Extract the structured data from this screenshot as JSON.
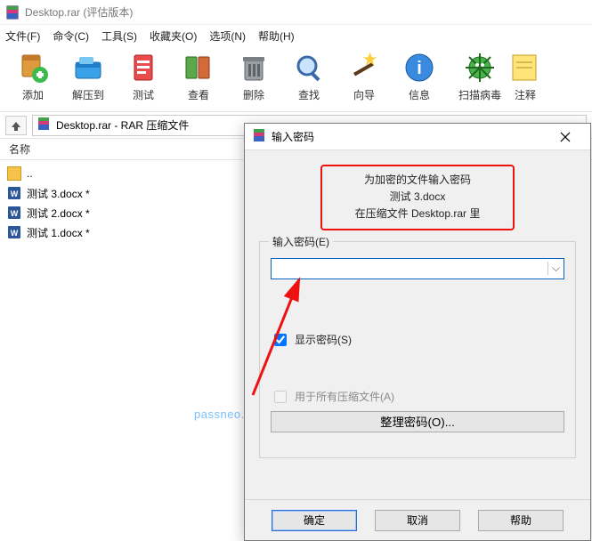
{
  "title": "Desktop.rar (评估版本)",
  "menus": [
    "文件(F)",
    "命令(C)",
    "工具(S)",
    "收藏夹(O)",
    "选项(N)",
    "帮助(H)"
  ],
  "toolbar": [
    {
      "label": "添加",
      "icon": "add"
    },
    {
      "label": "解压到",
      "icon": "extract"
    },
    {
      "label": "测试",
      "icon": "test"
    },
    {
      "label": "查看",
      "icon": "view"
    },
    {
      "label": "删除",
      "icon": "delete"
    },
    {
      "label": "查找",
      "icon": "find"
    },
    {
      "label": "向导",
      "icon": "wizard"
    },
    {
      "label": "信息",
      "icon": "info"
    },
    {
      "label": "扫描病毒",
      "icon": "virus"
    },
    {
      "label": "注释",
      "icon": "comment"
    }
  ],
  "path": "Desktop.rar - RAR 压缩文件",
  "column_header": "名称",
  "files": [
    {
      "name": "..",
      "type": "up"
    },
    {
      "name": "测试 3.docx *",
      "type": "doc"
    },
    {
      "name": "测试 2.docx *",
      "type": "doc"
    },
    {
      "name": "测试 1.docx *",
      "type": "doc"
    }
  ],
  "watermark": "passneo.cn",
  "dialog": {
    "title": "输入密码",
    "prompt_l1": "为加密的文件输入密码",
    "prompt_l2": "测试 3.docx",
    "prompt_l3": "在压缩文件 Desktop.rar 里",
    "group_label": "输入密码(E)",
    "password_value": "",
    "show_pwd": "显示密码(S)",
    "use_all": "用于所有压缩文件(A)",
    "organize": "整理密码(O)...",
    "ok": "确定",
    "cancel": "取消",
    "help": "帮助"
  }
}
